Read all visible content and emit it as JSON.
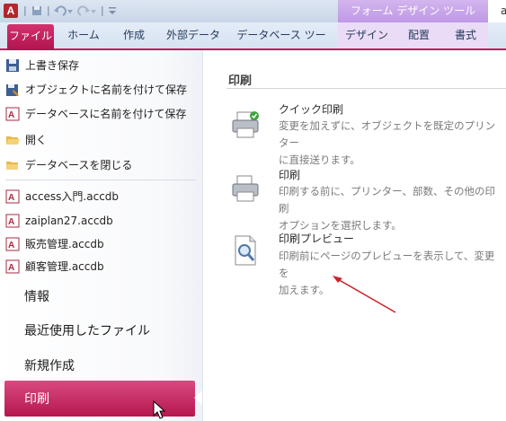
{
  "app_icon_letter": "A",
  "context_tab_header": "フォーム デザイン ツール",
  "context_tab_header_cut": "a",
  "tabs": [
    "ファイル",
    "ホーム",
    "作成",
    "外部データ",
    "データベース ツール",
    "デザイン",
    "配置",
    "書式"
  ],
  "file_menu": {
    "commands": [
      "上書き保存",
      "オブジェクトに名前を付けて保存",
      "データベースに名前を付けて保存",
      "開く",
      "データベースを閉じる"
    ],
    "recent_files": [
      "access入門.accdb",
      "zaiplan27.accdb",
      "販売管理.accdb",
      "顧客管理.accdb"
    ],
    "sections": [
      "情報",
      "最近使用したファイル",
      "新規作成"
    ],
    "selected_section": "印刷"
  },
  "print_panel": {
    "title": "印刷",
    "options": [
      {
        "icon": "quick-print-icon",
        "title": "クイック印刷",
        "desc_line1": "変更を加えずに、オブジェクトを既定のプリンター",
        "desc_line2": "に直接送ります。"
      },
      {
        "icon": "print-icon",
        "title": "印刷",
        "desc_line1": "印刷する前に、プリンター、部数、その他の印刷",
        "desc_line2": "オプションを選択します。"
      },
      {
        "icon": "print-preview-icon",
        "title": "印刷プレビュー",
        "desc_line1": "印刷前にページのプレビューを表示して、変更を",
        "desc_line2": "加えます。"
      }
    ]
  },
  "colors": {
    "file_accent": "#c8175d",
    "context_accent": "#bf98e6",
    "annotation_arrow": "#d0202a"
  }
}
